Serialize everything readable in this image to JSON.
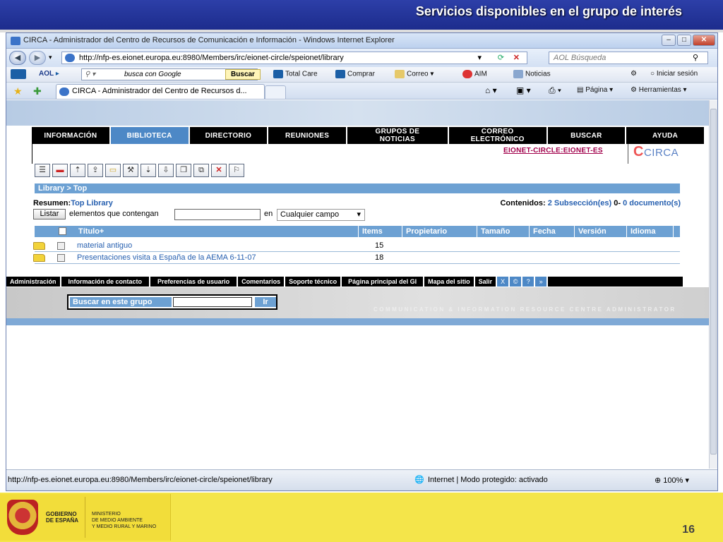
{
  "slide": {
    "title": "Servicios disponibles en el grupo de interés",
    "page_number": "16",
    "logo_gobierno": "GOBIERNO\nDE ESPAÑA",
    "logo_ministerio": "MINISTERIO\nDE MEDIO AMBIENTE\nY MEDIO RURAL Y MARINO"
  },
  "browser": {
    "window_title": "CIRCA - Administrador del Centro de Recursos de Comunicación e Información - Windows Internet Explorer",
    "url": "http://nfp-es.eionet.europa.eu:8980/Members/irc/eionet-circle/speionet/library",
    "search_placeholder": "AOL Búsqueda",
    "toolbar": {
      "google_placeholder": "busca con Google",
      "buscar": "Buscar",
      "total_care": "Total Care",
      "comprar": "Comprar",
      "correo": "Correo",
      "aim": "AIM",
      "noticias": "Noticias",
      "iniciar_sesion": "Iniciar sesión"
    },
    "tab_title": "CIRCA - Administrador del Centro de Recursos d...",
    "menu": {
      "pagina": "Página",
      "herramientas": "Herramientas"
    },
    "status": {
      "url": "http://nfp-es.eionet.europa.eu:8980/Members/irc/eionet-circle/speionet/library",
      "zone": "Internet | Modo protegido: activado",
      "zoom": "100%"
    }
  },
  "circa": {
    "nav": [
      "INFORMACIÓN",
      "BIBLIOTECA",
      "DIRECTORIO",
      "REUNIONES",
      "GRUPOS DE NOTICIAS",
      "CORREO ELECTRÓNICO",
      "BUSCAR",
      "AYUDA"
    ],
    "group_link": "EIONET-CIRCLE:EIONET-ES",
    "logo": "CIRCA",
    "breadcrumb": "Library > Top",
    "resumen_label": "Resumen:",
    "resumen_link": "Top Library",
    "contenidos_label": "Contenidos:",
    "contenidos_sub": "2 Subsección(es)",
    "contenidos_mid": "0-",
    "contenidos_docs": "0 documento(s)",
    "listar": "Listar",
    "elementos_text": "elementos que contengan",
    "en_text": "en",
    "field_select": "Cualquier campo",
    "columns": [
      "Título+",
      "Items",
      "Propietario",
      "Tamaño",
      "Fecha",
      "Versión",
      "Idioma"
    ],
    "rows": [
      {
        "title": "material antiguo",
        "items": "15"
      },
      {
        "title": "Presentaciones visita a España de la AEMA 6-11-07",
        "items": "18"
      }
    ],
    "footer_links": [
      "Administración",
      "Información de contacto",
      "Preferencias de usuario",
      "Comentarios",
      "Soporte técnico",
      "Página principal del GI",
      "Mapa del sitio",
      "Salir"
    ],
    "footer_icons": [
      "X",
      "©",
      "?",
      "»"
    ],
    "search_group_label": "Buscar en este grupo",
    "ir": "Ir",
    "comm_text": "COMMUNICATION & INFORMATION RESOURCE CENTRE ADMINISTRATOR"
  }
}
